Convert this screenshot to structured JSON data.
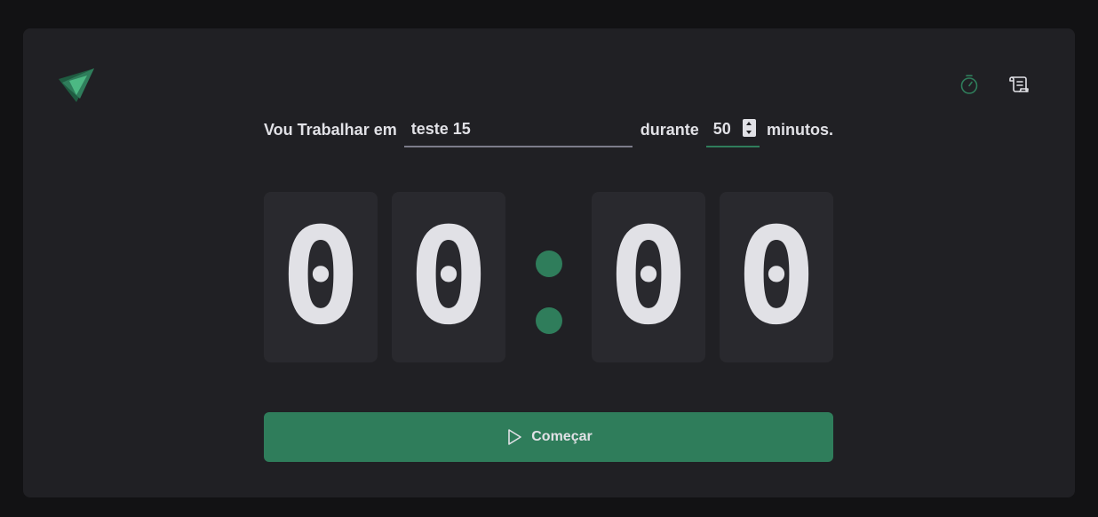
{
  "header": {
    "logo_icon": "triangle-logo-icon",
    "nav": [
      {
        "icon": "timer-icon",
        "label": "Timer",
        "active": true
      },
      {
        "icon": "scroll-icon",
        "label": "History",
        "active": false
      }
    ]
  },
  "form": {
    "task_prefix": "Vou Trabalhar em",
    "task_value": "teste 15",
    "duration_label": "durante",
    "minutes_value": "50",
    "suffix": "minutos."
  },
  "countdown": {
    "minutes_tens": "0",
    "minutes_ones": "0",
    "separator": ":",
    "seconds_tens": "0",
    "seconds_ones": "0"
  },
  "start_button": {
    "icon": "play-icon",
    "label": "Começar"
  },
  "colors": {
    "background": "#121214",
    "card": "#202024",
    "digit_bg": "#29292e",
    "accent": "#2f7d5b",
    "text": "#e1e1e6"
  }
}
